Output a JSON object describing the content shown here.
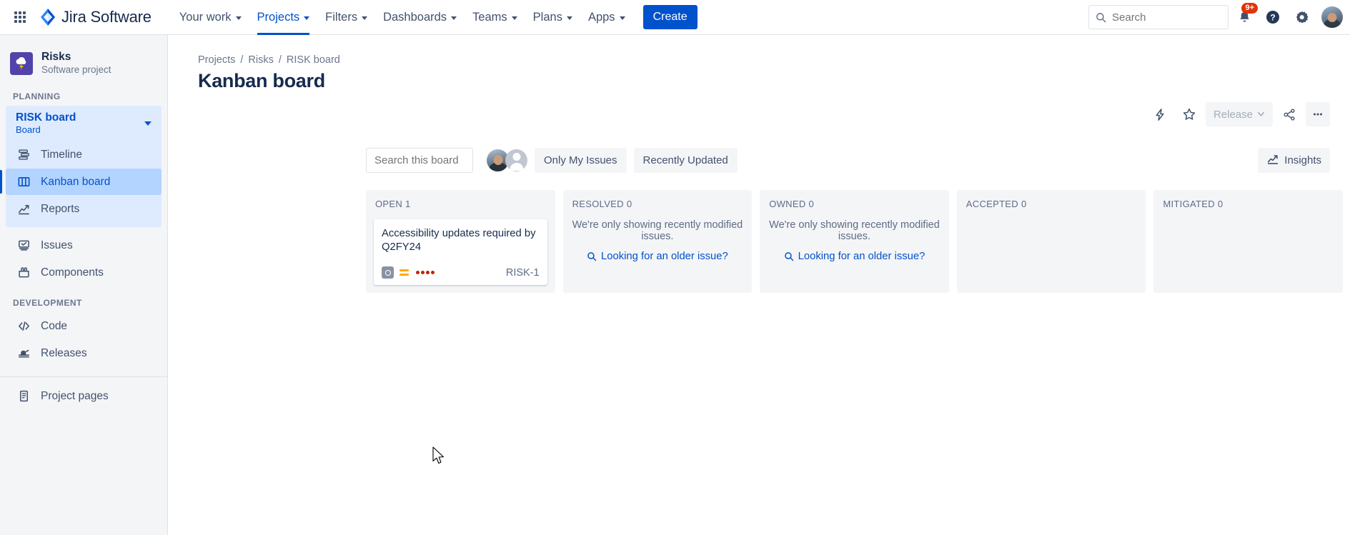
{
  "topnav": {
    "apps_icon": "apps-grid-icon",
    "brand": "Jira Software",
    "items": [
      {
        "label": "Your work",
        "active": false
      },
      {
        "label": "Projects",
        "active": true
      },
      {
        "label": "Filters",
        "active": false
      },
      {
        "label": "Dashboards",
        "active": false
      },
      {
        "label": "Teams",
        "active": false
      },
      {
        "label": "Plans",
        "active": false
      },
      {
        "label": "Apps",
        "active": false
      }
    ],
    "create_label": "Create",
    "search_placeholder": "Search",
    "search_value": "",
    "notifications_badge": "9+",
    "help_icon": "help-icon",
    "settings_icon": "gear-icon",
    "profile_icon": "profile-avatar"
  },
  "sidebar": {
    "project_name": "Risks",
    "project_type": "Software project",
    "planning_label": "PLANNING",
    "board": {
      "title": "RISK board",
      "subtitle": "Board",
      "items": [
        {
          "label": "Timeline",
          "icon": "timeline-icon",
          "selected": false
        },
        {
          "label": "Kanban board",
          "icon": "board-icon",
          "selected": true
        },
        {
          "label": "Reports",
          "icon": "reports-icon",
          "selected": false
        }
      ]
    },
    "outer_items": [
      {
        "label": "Issues",
        "icon": "issues-icon"
      },
      {
        "label": "Components",
        "icon": "components-icon"
      }
    ],
    "development_label": "DEVELOPMENT",
    "development_items": [
      {
        "label": "Code",
        "icon": "code-icon"
      },
      {
        "label": "Releases",
        "icon": "releases-icon"
      }
    ],
    "footer_items": [
      {
        "label": "Project pages",
        "icon": "page-icon"
      }
    ]
  },
  "main": {
    "breadcrumb": [
      "Projects",
      "Risks",
      "RISK board"
    ],
    "breadcrumb_sep": "/",
    "title": "Kanban board",
    "title_actions": {
      "automation_icon": "lightning-icon",
      "star_icon": "star-icon",
      "release_label": "Release",
      "share_icon": "share-icon",
      "more_icon": "more-ellipsis-icon"
    },
    "toolbar": {
      "search_placeholder": "Search this board",
      "search_value": "",
      "search_icon": "search-icon",
      "avatars": [
        "user-avatar-photo",
        "user-avatar-generic"
      ],
      "only_my_issues": "Only My Issues",
      "recently_updated": "Recently Updated",
      "insights_label": "Insights",
      "insights_icon": "insights-chart-icon"
    }
  },
  "board": {
    "columns": [
      {
        "name": "OPEN",
        "count": "1",
        "empty_message": "",
        "older_link": "",
        "cards": [
          {
            "title": "Accessibility updates required by Q2FY24",
            "key": "RISK-1",
            "type_icon": "risk-type-icon",
            "priority_icon": "medium-priority-icon",
            "dots": 4
          }
        ]
      },
      {
        "name": "RESOLVED",
        "count": "0",
        "empty_message": "We're only showing recently modified issues.",
        "older_link": "Looking for an older issue?",
        "cards": []
      },
      {
        "name": "OWNED",
        "count": "0",
        "empty_message": "We're only showing recently modified issues.",
        "older_link": "Looking for an older issue?",
        "cards": []
      },
      {
        "name": "ACCEPTED",
        "count": "0",
        "empty_message": "",
        "older_link": "",
        "cards": []
      },
      {
        "name": "MITIGATED",
        "count": "0",
        "empty_message": "",
        "older_link": "",
        "cards": []
      }
    ]
  },
  "colors": {
    "brand_blue": "#0052cc",
    "sidebar_bg": "#f4f5f7",
    "selected_nav": "#b3d4ff",
    "board_group": "#deebff",
    "badge_red": "#de350b",
    "priority_orange": "#ffab00",
    "dot_red": "#bf2600",
    "project_icon_purple": "#5243aa"
  }
}
